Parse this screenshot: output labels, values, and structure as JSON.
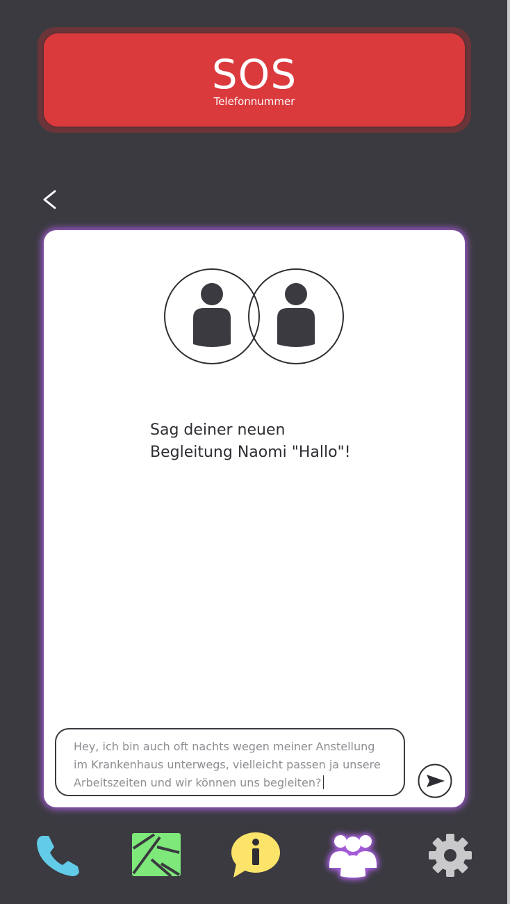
{
  "sos": {
    "title": "SOS",
    "subtitle": "Telefonnummer"
  },
  "chat": {
    "prompt": "Sag deiner neuen\nBegleitung Naomi \"Hallo\"!",
    "input_value": "Hey, ich bin auch oft nachts wegen meiner Anstellung im Krankenhaus unterwegs, vielleicht passen ja unsere Arbeitszeiten und wir können uns begleiten?"
  },
  "icons": {
    "back": "chevron-left-icon",
    "send": "send-icon",
    "avatars": "person-icon"
  },
  "nav": {
    "items": [
      {
        "name": "phone",
        "icon": "phone-icon",
        "color": "#62cbe8"
      },
      {
        "name": "map",
        "icon": "map-icon",
        "color": "#7ee87a"
      },
      {
        "name": "info",
        "icon": "info-icon",
        "color": "#fce36a"
      },
      {
        "name": "community",
        "icon": "people-icon",
        "color": "#ffffff",
        "active": true
      },
      {
        "name": "settings",
        "icon": "gear-icon",
        "color": "#c9c9cc"
      }
    ]
  },
  "colors": {
    "background": "#3b3a40",
    "sos_red": "#db3a3d",
    "accent_glow": "#b061eb"
  }
}
